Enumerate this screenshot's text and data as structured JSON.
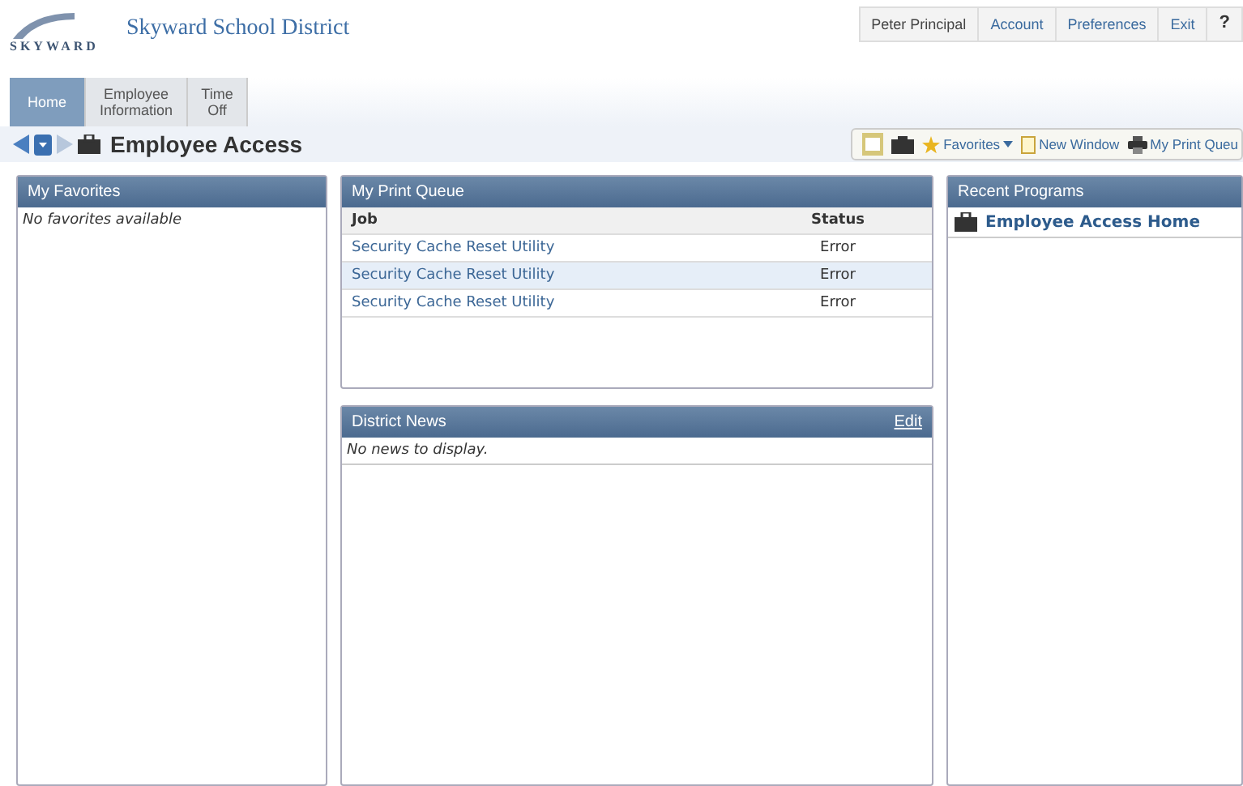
{
  "header": {
    "logo_text": "SKYWARD",
    "title": "Skyward School District",
    "user_links": [
      "Peter Principal",
      "Account",
      "Preferences",
      "Exit",
      "?"
    ]
  },
  "tabs": [
    {
      "label": "Home",
      "selected": true
    },
    {
      "label": "Employee Information",
      "selected": false
    },
    {
      "label": "Time Off",
      "selected": false
    }
  ],
  "page_title": "Employee Access",
  "toolbar": [
    {
      "kind": "icon"
    },
    {
      "kind": "icon2"
    },
    {
      "kind": "favorites",
      "label": "Favorites"
    },
    {
      "kind": "window",
      "label": "New Window"
    },
    {
      "kind": "print",
      "label": "My Print Queu"
    }
  ],
  "favorites": {
    "title": "My Favorites",
    "empty": "No favorites available"
  },
  "print_queue": {
    "title": "My Print Queue",
    "columns": [
      "Job",
      "Status"
    ],
    "rows": [
      {
        "job": "Security Cache Reset Utility",
        "status": "Error",
        "selected": false
      },
      {
        "job": "Security Cache Reset Utility",
        "status": "Error",
        "selected": true
      },
      {
        "job": "Security Cache Reset Utility",
        "status": "Error",
        "selected": false
      }
    ]
  },
  "news": {
    "title": "District News",
    "edit": "Edit",
    "empty": "No news to display."
  },
  "recent": {
    "title": "Recent Programs",
    "items": [
      "Employee Access Home"
    ]
  }
}
